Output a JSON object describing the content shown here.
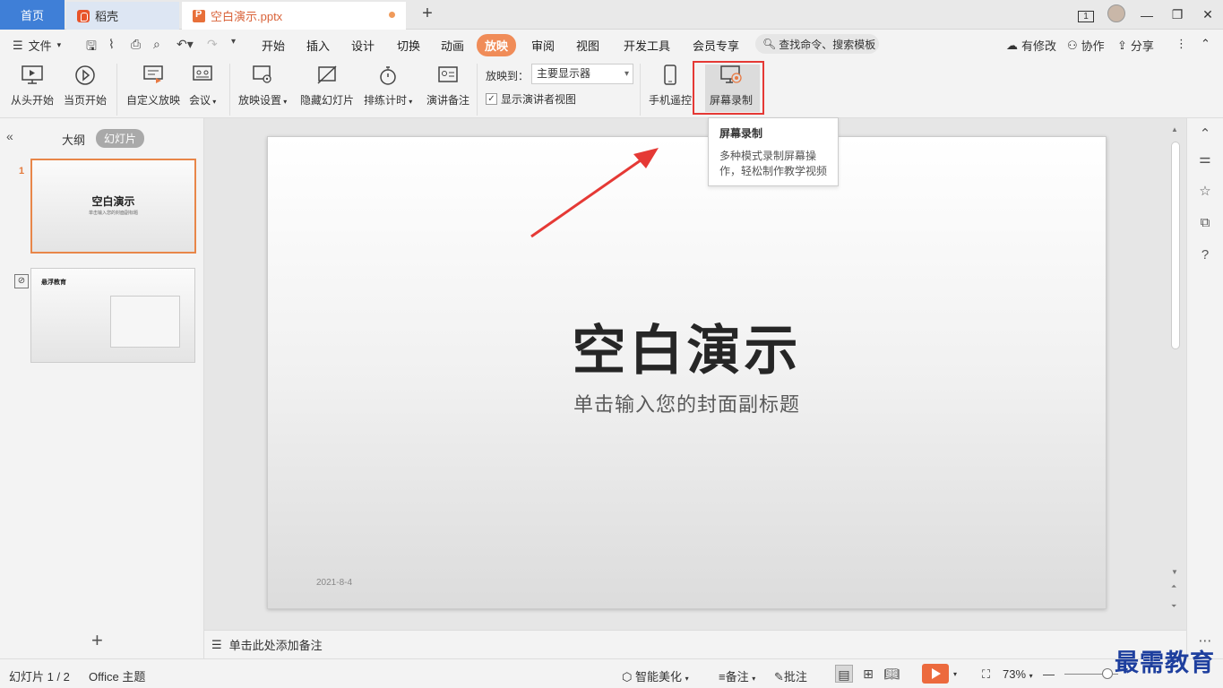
{
  "titlebar": {
    "tabs": [
      {
        "label": "首页"
      },
      {
        "label": "稻壳"
      },
      {
        "label": "空白演示.pptx"
      }
    ],
    "page_badge": "1"
  },
  "menubar": {
    "file": "文件",
    "tabs": [
      "开始",
      "插入",
      "设计",
      "切换",
      "动画",
      "放映",
      "审阅",
      "视图",
      "开发工具",
      "会员专享"
    ],
    "active_tab": "放映",
    "search_placeholder": "查找命令、搜索模板",
    "right": {
      "modify": "有修改",
      "collab": "协作",
      "share": "分享"
    }
  },
  "ribbon": {
    "from_start": "从头开始",
    "from_current": "当页开始",
    "custom_show": "自定义放映",
    "meeting": "会议",
    "show_settings": "放映设置",
    "hide_slide": "隐藏幻灯片",
    "rehearse": "排练计时",
    "speaker_notes": "演讲备注",
    "project_to_label": "放映到：",
    "project_to_value": "主要显示器",
    "presenter_view": "显示演讲者视图",
    "phone_remote": "手机遥控",
    "screen_record": "屏幕录制"
  },
  "tooltip": {
    "title": "屏幕录制",
    "desc": "多种模式录制屏幕操作，轻松制作教学视频"
  },
  "leftpanel": {
    "tab_outline": "大纲",
    "tab_slides": "幻灯片",
    "slides": [
      {
        "number": "1",
        "title": "空白演示",
        "subtitle": "单击输入您的封面副标题"
      },
      {
        "title": "悬浮教育"
      }
    ]
  },
  "slide": {
    "title": "空白演示",
    "subtitle": "单击输入您的封面副标题",
    "date": "2021-8-4"
  },
  "notes": {
    "placeholder": "单击此处添加备注"
  },
  "statusbar": {
    "slide_count": "幻灯片 1 / 2",
    "theme": "Office 主题",
    "beautify": "智能美化",
    "notes": "备注",
    "comments": "批注",
    "zoom": "73%"
  },
  "watermark": "最需教育",
  "colors": {
    "accent": "#f08c58",
    "highlight": "#e53935",
    "home_tab": "#3f7fd7"
  }
}
